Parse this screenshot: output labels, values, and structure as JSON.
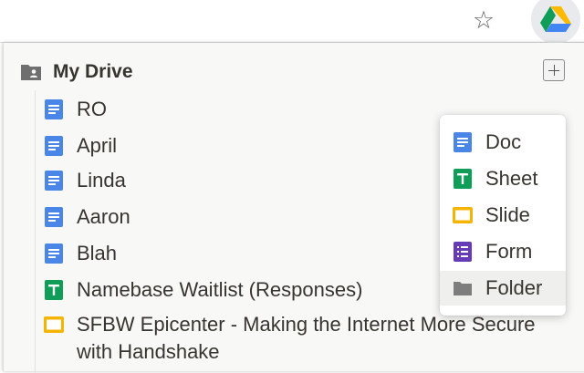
{
  "browser": {
    "star_icon": "star-outline-icon",
    "extension_icon": "google-drive-logo-icon"
  },
  "drive": {
    "title": "My Drive",
    "icon": "shared-folder-icon"
  },
  "files": [
    {
      "name": "RO",
      "type": "doc"
    },
    {
      "name": "April",
      "type": "doc"
    },
    {
      "name": "Linda",
      "type": "doc"
    },
    {
      "name": "Aaron",
      "type": "doc"
    },
    {
      "name": "Blah",
      "type": "doc"
    },
    {
      "name": "Namebase Waitlist (Responses)",
      "type": "sheet"
    },
    {
      "name": "SFBW Epicenter - Making the Internet More Secure with Handshake",
      "type": "slide"
    }
  ],
  "new_menu": {
    "button_icon": "plus-icon",
    "items": [
      {
        "label": "Doc",
        "type": "doc"
      },
      {
        "label": "Sheet",
        "type": "sheet"
      },
      {
        "label": "Slide",
        "type": "slide"
      },
      {
        "label": "Form",
        "type": "form"
      },
      {
        "label": "Folder",
        "type": "folder"
      }
    ],
    "highlighted": "Folder"
  },
  "colors": {
    "doc": "#4a86e8",
    "sheet": "#0f9d58",
    "slide": "#f4b400",
    "form": "#673ab7",
    "folder": "#8a8a8a",
    "text": "#37352f"
  }
}
